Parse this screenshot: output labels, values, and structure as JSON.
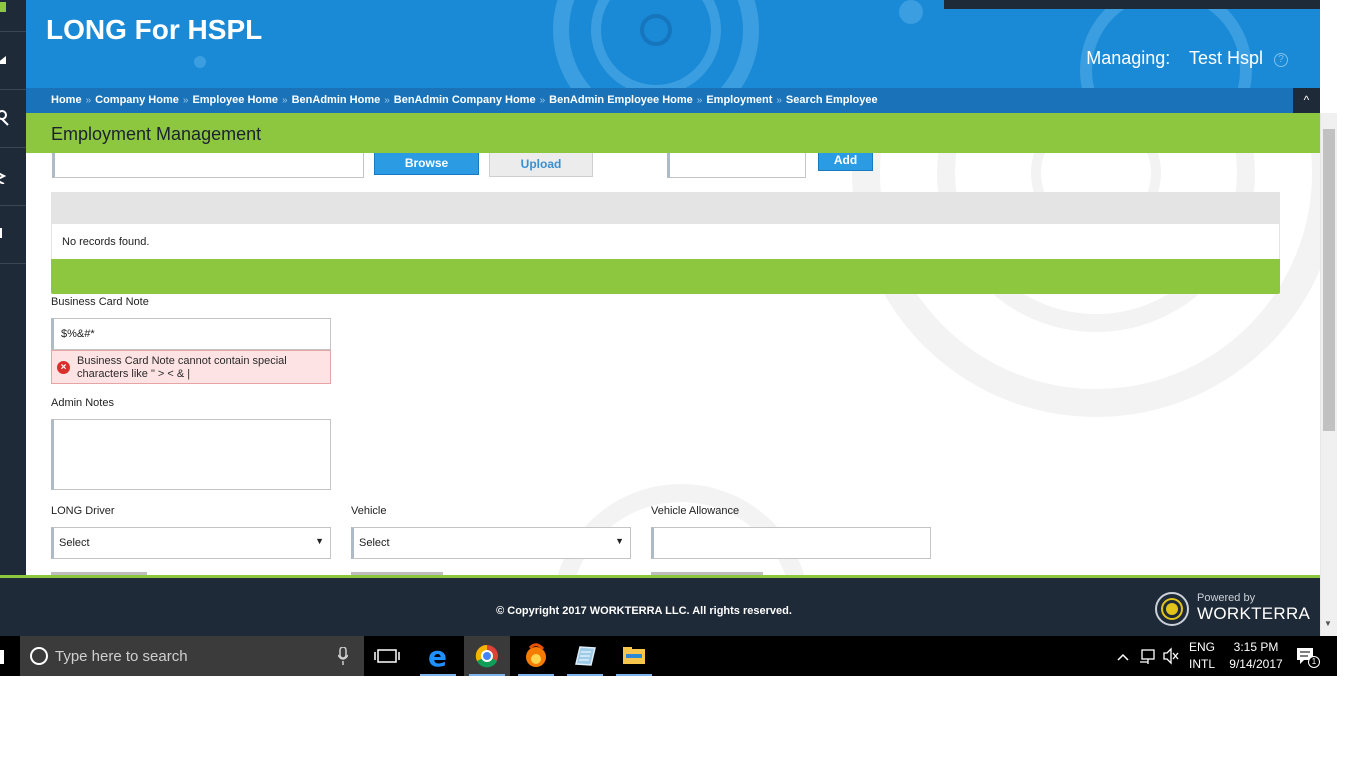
{
  "header": {
    "brand": "LONG For HSPL",
    "managing_label": "Managing:",
    "managing_value": "Test Hspl",
    "info_glyph": "?"
  },
  "breadcrumb": [
    "Home",
    "Company Home",
    "Employee Home",
    "BenAdmin Home",
    "BenAdmin Company Home",
    "BenAdmin Employee Home",
    "Employment",
    "Search Employee"
  ],
  "breadcrumb_separator": "»",
  "collapse_glyph": "^",
  "page_title": "Employment Management",
  "upload_row": {
    "browse_label": "Browse",
    "upload_label": "Upload",
    "add_label": "Add"
  },
  "grid": {
    "empty_message": "No records found."
  },
  "form": {
    "business_card_note_label": "Business Card Note",
    "business_card_note_value": "$%&#*",
    "business_card_error": "Business Card Note cannot contain special characters like \" > < & |",
    "error_glyph": "×",
    "admin_notes_label": "Admin Notes",
    "long_driver_label": "LONG Driver",
    "long_driver_value": "Select",
    "vehicle_label": "Vehicle",
    "vehicle_value": "Select",
    "vehicle_allowance_label": "Vehicle Allowance",
    "select_arrow": "▼"
  },
  "footer": {
    "copyright": "© Copyright 2017 WORKTERRA LLC. All rights reserved.",
    "powered_by": "Powered by",
    "brand": "WORKTERRA"
  },
  "taskbar": {
    "search_placeholder": "Type here to search",
    "lang_line1": "ENG",
    "lang_line2": "INTL",
    "time": "3:15 PM",
    "date": "9/14/2017",
    "notification_count": "1"
  },
  "colors": {
    "header_blue": "#1b8ad6",
    "breadcrumb_blue": "#1a73b8",
    "accent_green": "#8dc63f",
    "dark_navy": "#1f2a38",
    "button_blue": "#2b9be4",
    "error_red": "#d9302c"
  }
}
